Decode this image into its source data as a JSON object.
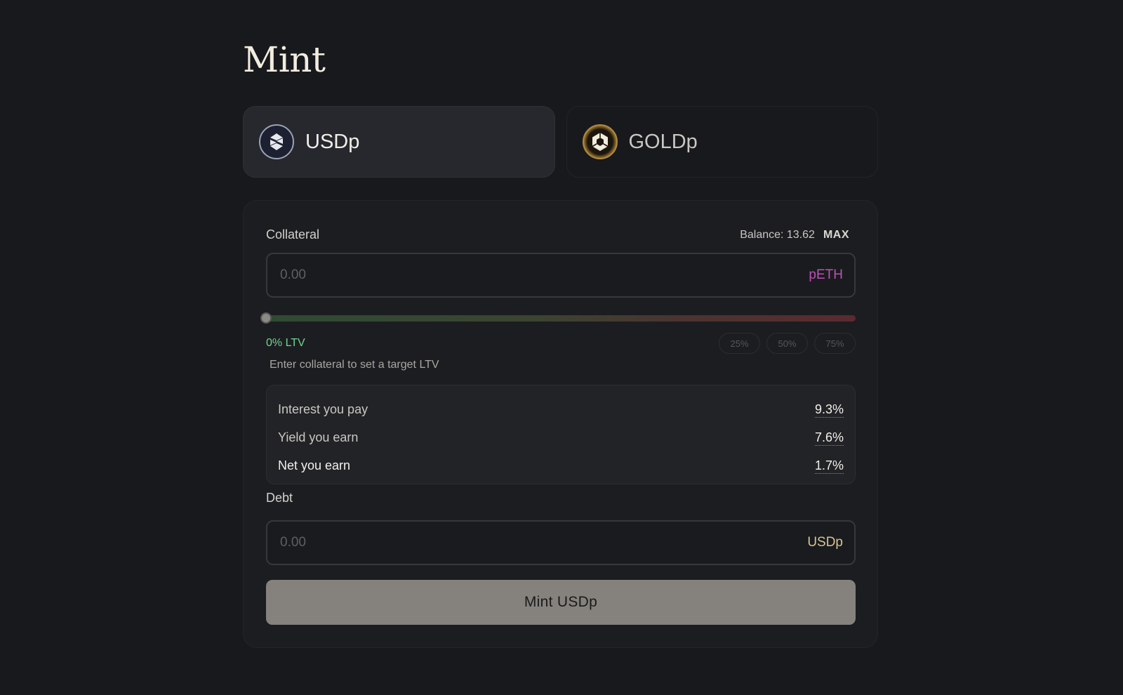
{
  "page": {
    "title": "Mint"
  },
  "tokens": [
    {
      "label": "USDp",
      "icon": "usdp-logo-icon",
      "selected": true
    },
    {
      "label": "GOLDp",
      "icon": "goldp-logo-icon",
      "selected": false
    }
  ],
  "collateral": {
    "label": "Collateral",
    "balance_text": "Balance: 13.62",
    "max_label": "MAX",
    "placeholder": "0.00",
    "value": "",
    "unit": "pETH"
  },
  "ltv": {
    "value_percent": 0,
    "value_text": "0% LTV",
    "presets": [
      "25%",
      "50%",
      "75%"
    ],
    "hint": "Enter collateral to set a target LTV"
  },
  "rates": {
    "interest_label": "Interest you pay",
    "interest_value": "9.3%",
    "yield_label": "Yield you earn",
    "yield_value": "7.6%",
    "net_label": "Net you earn",
    "net_value": "1.7%"
  },
  "debt": {
    "label": "Debt",
    "placeholder": "0.00",
    "value": "",
    "unit": "USDp"
  },
  "submit": {
    "label": "Mint USDp"
  },
  "colors": {
    "background": "#18191d",
    "card": "#1c1d21",
    "ltv_text": "#6fd58e",
    "peth_unit": "#c04fb7",
    "usdp_unit": "#d9c48e",
    "mint_button": "#85827e"
  }
}
